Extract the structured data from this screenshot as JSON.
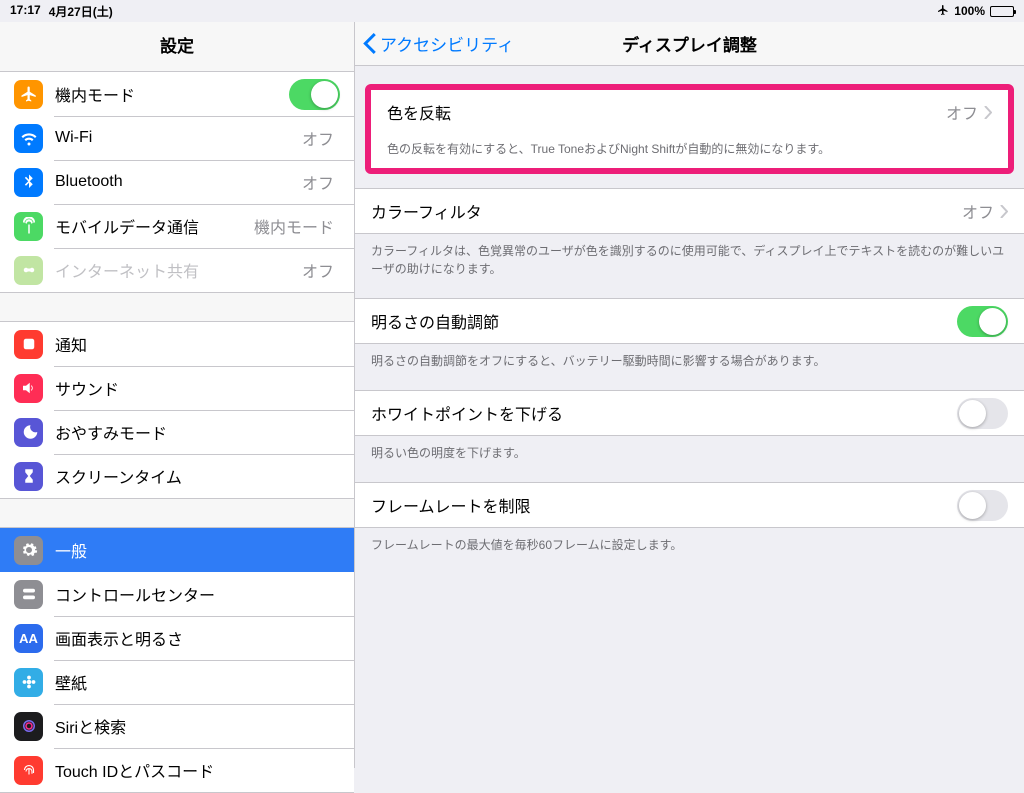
{
  "status": {
    "time": "17:17",
    "date": "4月27日(土)",
    "battery_pct": "100%"
  },
  "sidebar": {
    "title": "設定",
    "group1": [
      {
        "label": "機内モード",
        "switch_on": true
      },
      {
        "label": "Wi-Fi",
        "detail": "オフ"
      },
      {
        "label": "Bluetooth",
        "detail": "オフ"
      },
      {
        "label": "モバイルデータ通信",
        "detail": "機内モード"
      },
      {
        "label": "インターネット共有",
        "detail": "オフ",
        "dim": true
      }
    ],
    "group2": [
      {
        "label": "通知"
      },
      {
        "label": "サウンド"
      },
      {
        "label": "おやすみモード"
      },
      {
        "label": "スクリーンタイム"
      }
    ],
    "group3": [
      {
        "label": "一般",
        "selected": true
      },
      {
        "label": "コントロールセンター"
      },
      {
        "label": "画面表示と明るさ"
      },
      {
        "label": "壁紙"
      },
      {
        "label": "Siriと検索"
      },
      {
        "label": "Touch IDとパスコード"
      }
    ]
  },
  "main": {
    "back_label": "アクセシビリティ",
    "title": "ディスプレイ調整",
    "invert": {
      "label": "色を反転",
      "value": "オフ",
      "footer": "色の反転を有効にすると、True ToneおよびNight Shiftが自動的に無効になります。"
    },
    "color_filter": {
      "label": "カラーフィルタ",
      "value": "オフ",
      "footer": "カラーフィルタは、色覚異常のユーザが色を識別するのに使用可能で、ディスプレイ上でテキストを読むのが難しいユーザの助けになります。"
    },
    "auto_brightness": {
      "label": "明るさの自動調節",
      "on": true,
      "footer": "明るさの自動調節をオフにすると、バッテリー駆動時間に影響する場合があります。"
    },
    "white_point": {
      "label": "ホワイトポイントを下げる",
      "on": false,
      "footer": "明るい色の明度を下げます。"
    },
    "frame_rate": {
      "label": "フレームレートを制限",
      "on": false,
      "footer": "フレームレートの最大値を毎秒60フレームに設定します。"
    }
  }
}
